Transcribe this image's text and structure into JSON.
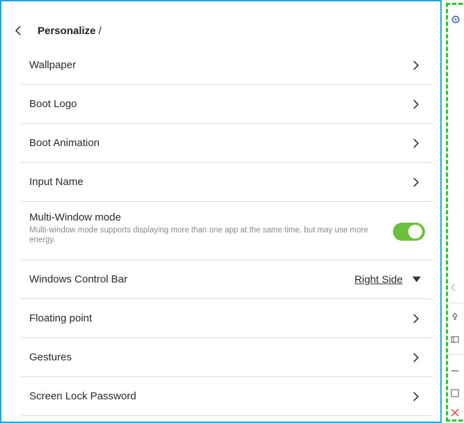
{
  "header": {
    "title": "Personalize",
    "separator": "/"
  },
  "items": [
    {
      "label": "Wallpaper"
    },
    {
      "label": "Boot Logo"
    },
    {
      "label": "Boot Animation"
    },
    {
      "label": "Input Name"
    }
  ],
  "multi_window": {
    "label": "Multi-Window mode",
    "description": "Multi-window mode supports displaying more than one app at the same time, but may use more energy.",
    "enabled": true
  },
  "control_bar": {
    "label": "Windows Control Bar",
    "value": "Right Side"
  },
  "items2": [
    {
      "label": "Floating point"
    },
    {
      "label": "Gestures"
    },
    {
      "label": "Screen Lock Password"
    }
  ],
  "sidebar": {
    "icons": [
      "gear-icon",
      "chevron-left-icon",
      "pin-icon",
      "window-icon",
      "minimize-icon",
      "maximize-icon",
      "close-icon"
    ]
  },
  "colors": {
    "accent_border": "#1ea7e0",
    "toggle_on": "#6cbf3f",
    "sidebar_dash": "#22cc22",
    "close": "#e53935"
  }
}
